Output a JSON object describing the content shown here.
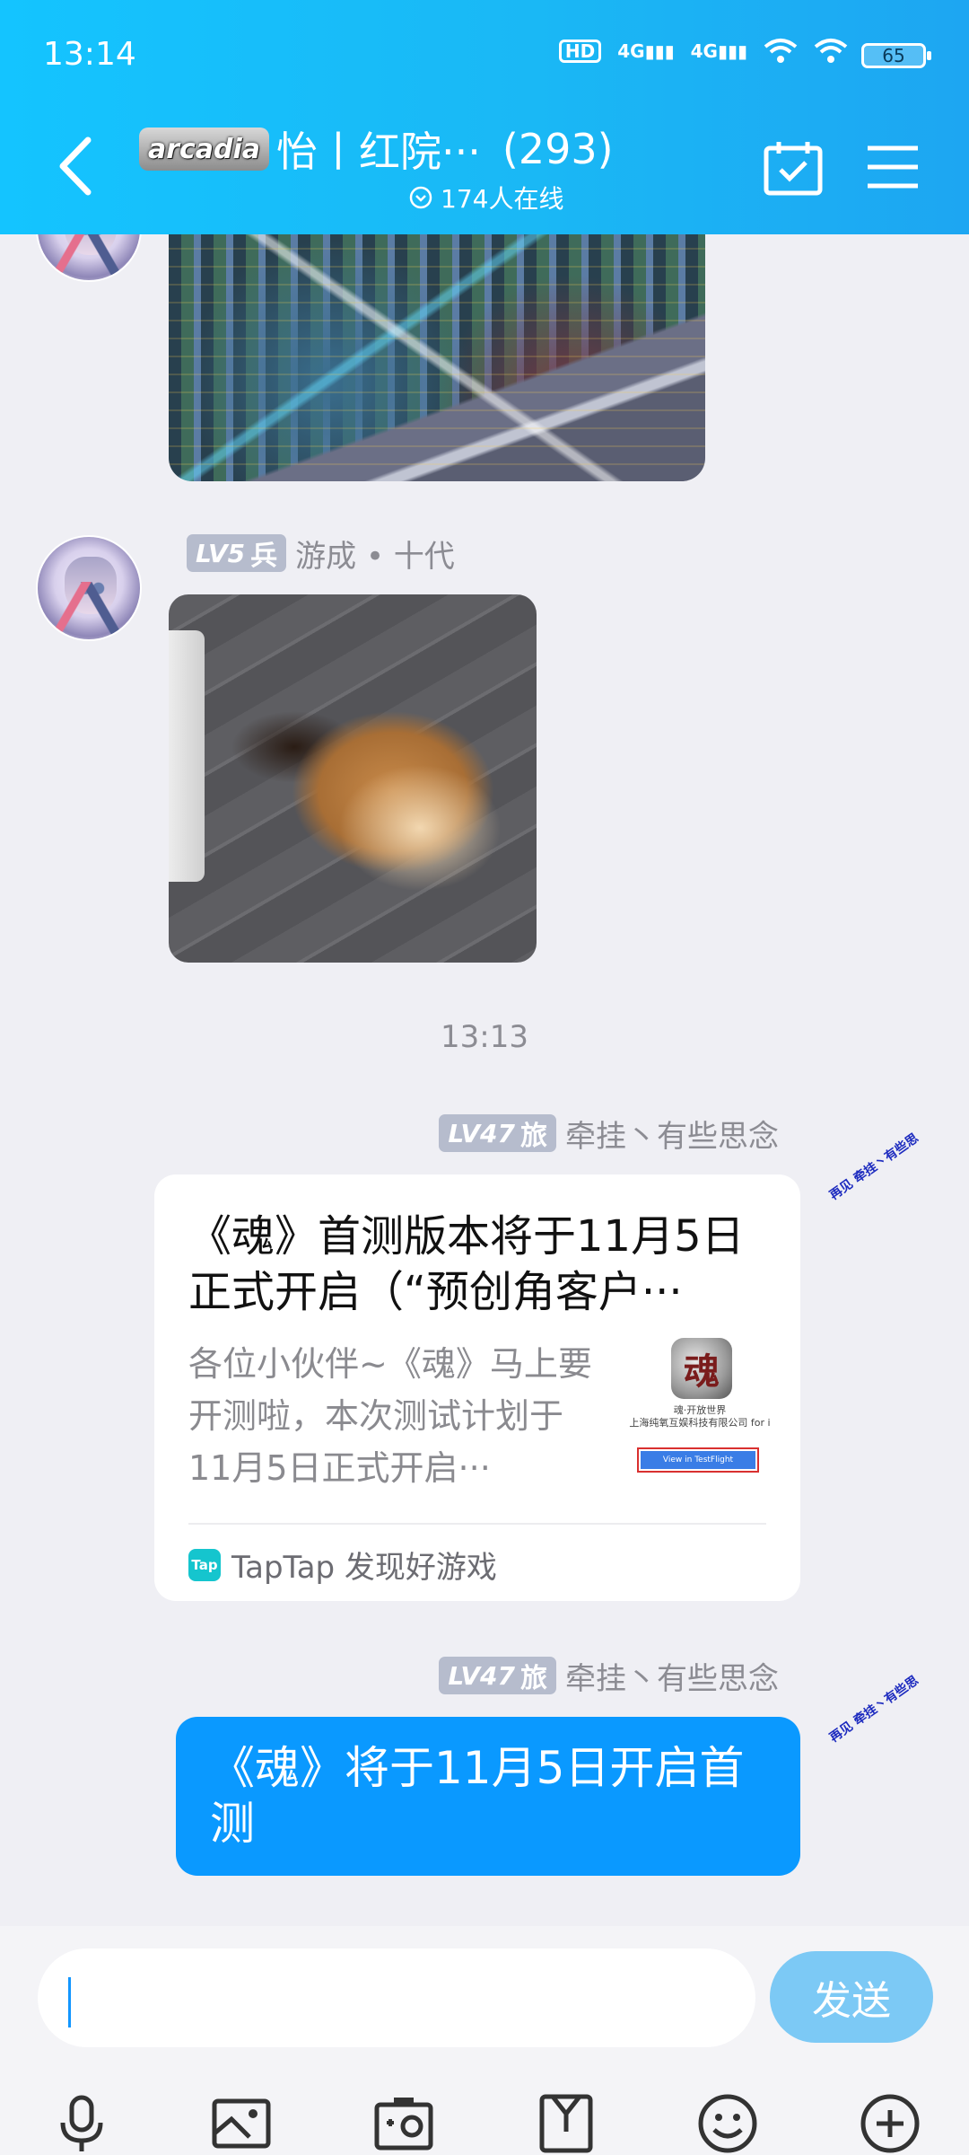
{
  "status_bar": {
    "time": "13:14",
    "hd_label": "HD",
    "network_1": "4G",
    "network_2": "4G",
    "battery": "65"
  },
  "header": {
    "logo_text": "arcadia",
    "title": "怡丨红院···",
    "member_count": "(293)",
    "online": "174人在线"
  },
  "messages": [
    {
      "type": "image",
      "image_desc": "game-screenshot"
    },
    {
      "type": "image",
      "badge_level": "LV5",
      "badge_rank": "兵",
      "sender": "游成 • 十代",
      "image_desc": "dog-gif"
    },
    {
      "type": "timestamp",
      "text": "13:13"
    },
    {
      "type": "link_card",
      "badge_level": "LV47",
      "badge_rank": "旅",
      "sender": "牵挂丶有些思念",
      "sticker": "再见 牵挂丶有些思",
      "title": "《魂》首测版本将于11月5日正式开启（“预创角客户···",
      "description": "各位小伙伴~《魂》马上要开测啦，本次测试计划于11月5日正式开启···",
      "thumb_logo": "魂",
      "thumb_line1": "魂·开放世界",
      "thumb_line2": "上海纯氧互娱科技有限公司 for i",
      "thumb_button": "View in TestFlight",
      "source_icon": "Tap",
      "source": "TapTap 发现好游戏"
    },
    {
      "type": "text",
      "badge_level": "LV47",
      "badge_rank": "旅",
      "sender": "牵挂丶有些思念",
      "sticker": "再见 牵挂丶有些思",
      "text": "《魂》将于11月5日开启首测"
    }
  ],
  "input": {
    "value": "",
    "send_label": "发送"
  },
  "toolbar": [
    "mic-icon",
    "image-icon",
    "camera-icon",
    "file-icon",
    "emoji-icon",
    "plus-icon"
  ],
  "colors": {
    "header": "#1ab8f5",
    "bubble": "#0a99ff",
    "send_button": "#7cc9f5",
    "badge": "#b6bccd"
  }
}
